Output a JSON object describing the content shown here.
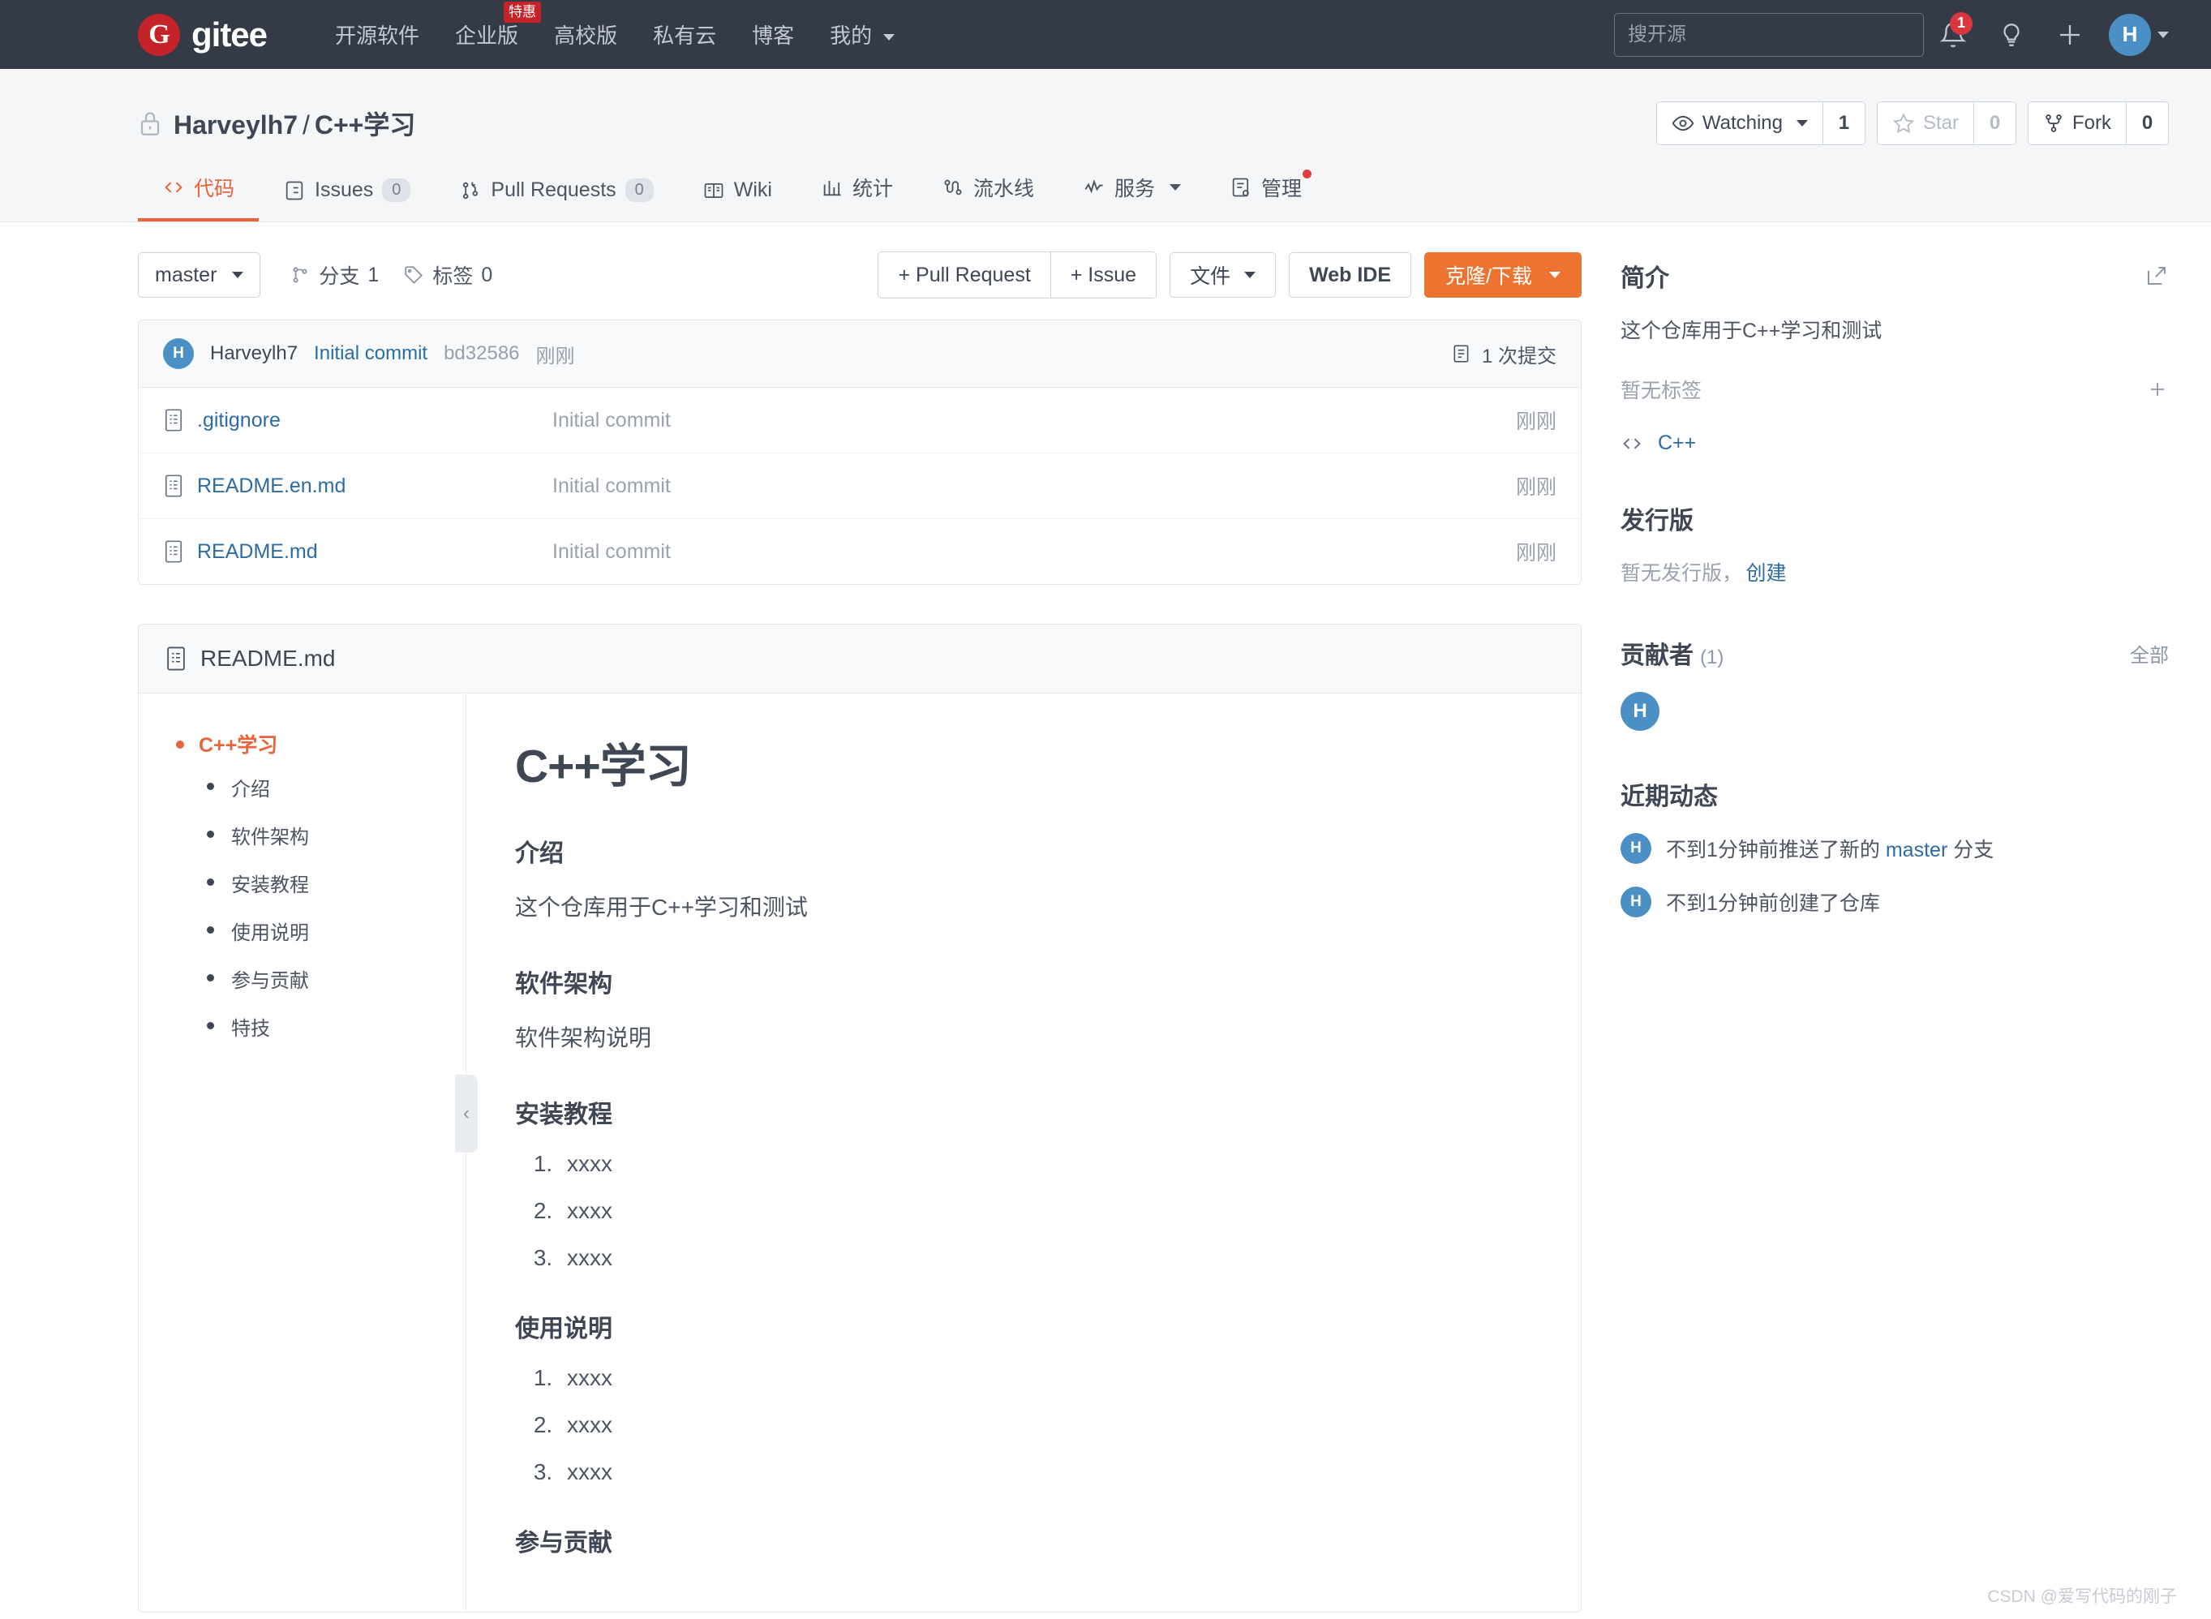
{
  "header": {
    "brand_letter": "G",
    "brand_name": "gitee",
    "nav": [
      {
        "label": "开源软件",
        "badge": null
      },
      {
        "label": "企业版",
        "badge": "特惠"
      },
      {
        "label": "高校版",
        "badge": null
      },
      {
        "label": "私有云",
        "badge": null
      },
      {
        "label": "博客",
        "badge": null
      },
      {
        "label": "我的",
        "badge": null,
        "has_caret": true
      }
    ],
    "search_placeholder": "搜开源",
    "search_value": "",
    "notification_count": "1",
    "avatar_letter": "H",
    "icons": {
      "bell": "bell-icon",
      "lightbulb": "lightbulb-icon",
      "plus": "plus-icon"
    }
  },
  "repo": {
    "owner": "Harveylh7",
    "name": "C++学习",
    "separator": "/",
    "private": true,
    "watch": {
      "label": "Watching",
      "count": "1"
    },
    "star": {
      "label": "Star",
      "count": "0"
    },
    "fork": {
      "label": "Fork",
      "count": "0"
    },
    "tabs": [
      {
        "label": "代码",
        "count": null,
        "active": true,
        "icon": "code-icon"
      },
      {
        "label": "Issues",
        "count": "0",
        "active": false,
        "icon": "issues-icon"
      },
      {
        "label": "Pull Requests",
        "count": "0",
        "active": false,
        "icon": "pull-request-icon"
      },
      {
        "label": "Wiki",
        "count": null,
        "active": false,
        "icon": "book-icon"
      },
      {
        "label": "统计",
        "count": null,
        "active": false,
        "icon": "chart-icon"
      },
      {
        "label": "流水线",
        "count": null,
        "active": false,
        "icon": "pipeline-icon"
      },
      {
        "label": "服务",
        "count": null,
        "active": false,
        "icon": "service-icon",
        "has_caret": true
      },
      {
        "label": "管理",
        "count": null,
        "active": false,
        "icon": "manage-icon",
        "dot": true
      }
    ]
  },
  "toolbar": {
    "branch": "master",
    "branches_label": "分支",
    "branches_count": "1",
    "tags_label": "标签",
    "tags_count": "0",
    "pull_request_btn": "+ Pull Request",
    "issue_btn": "+ Issue",
    "files_btn": "文件",
    "webide_btn": "Web IDE",
    "clone_btn": "克隆/下载"
  },
  "commit_bar": {
    "avatar_letter": "H",
    "author": "Harveylh7",
    "message": "Initial commit",
    "hash": "bd32586",
    "time": "刚刚",
    "commits_count_label": "1 次提交"
  },
  "files": [
    {
      "name": ".gitignore",
      "message": "Initial commit",
      "time": "刚刚"
    },
    {
      "name": "README.en.md",
      "message": "Initial commit",
      "time": "刚刚"
    },
    {
      "name": "README.md",
      "message": "Initial commit",
      "time": "刚刚"
    }
  ],
  "readme": {
    "filename": "README.md",
    "toc_top": "C++学习",
    "toc_items": [
      "介绍",
      "软件架构",
      "安装教程",
      "使用说明",
      "参与贡献",
      "特技"
    ],
    "title": "C++学习",
    "sections": [
      {
        "heading": "介绍",
        "paragraph": "这个仓库用于C++学习和测试",
        "list": []
      },
      {
        "heading": "软件架构",
        "paragraph": "软件架构说明",
        "list": []
      },
      {
        "heading": "安装教程",
        "paragraph": "",
        "list": [
          "xxxx",
          "xxxx",
          "xxxx"
        ]
      },
      {
        "heading": "使用说明",
        "paragraph": "",
        "list": [
          "xxxx",
          "xxxx",
          "xxxx"
        ]
      },
      {
        "heading": "参与贡献",
        "paragraph": "",
        "list": []
      }
    ]
  },
  "sidebar": {
    "intro_title": "简介",
    "intro_text": "这个仓库用于C++学习和测试",
    "no_tags_text": "暂无标签",
    "language": "C++",
    "releases_title": "发行版",
    "no_releases_text": "暂无发行版，",
    "create_release_link": "创建",
    "contributors_title": "贡献者",
    "contributors_count": "(1)",
    "contributors_all_link": "全部",
    "contributor_avatars": [
      "H"
    ],
    "activity_title": "近期动态",
    "activities": [
      {
        "avatar": "H",
        "text_before": "不到1分钟前推送了新的 ",
        "link": "master",
        "text_after": " 分支"
      },
      {
        "avatar": "H",
        "text_before": "不到1分钟前创建了仓库",
        "link": "",
        "text_after": ""
      }
    ]
  },
  "watermark": "CSDN @爱写代码的刚子",
  "colors": {
    "header_bg": "#353b46",
    "accent_orange": "#e8643c",
    "clone_orange": "#ec7430",
    "link_blue": "#2d6ca2",
    "avatar_blue": "#4a90c4",
    "brand_red": "#c6222a"
  }
}
